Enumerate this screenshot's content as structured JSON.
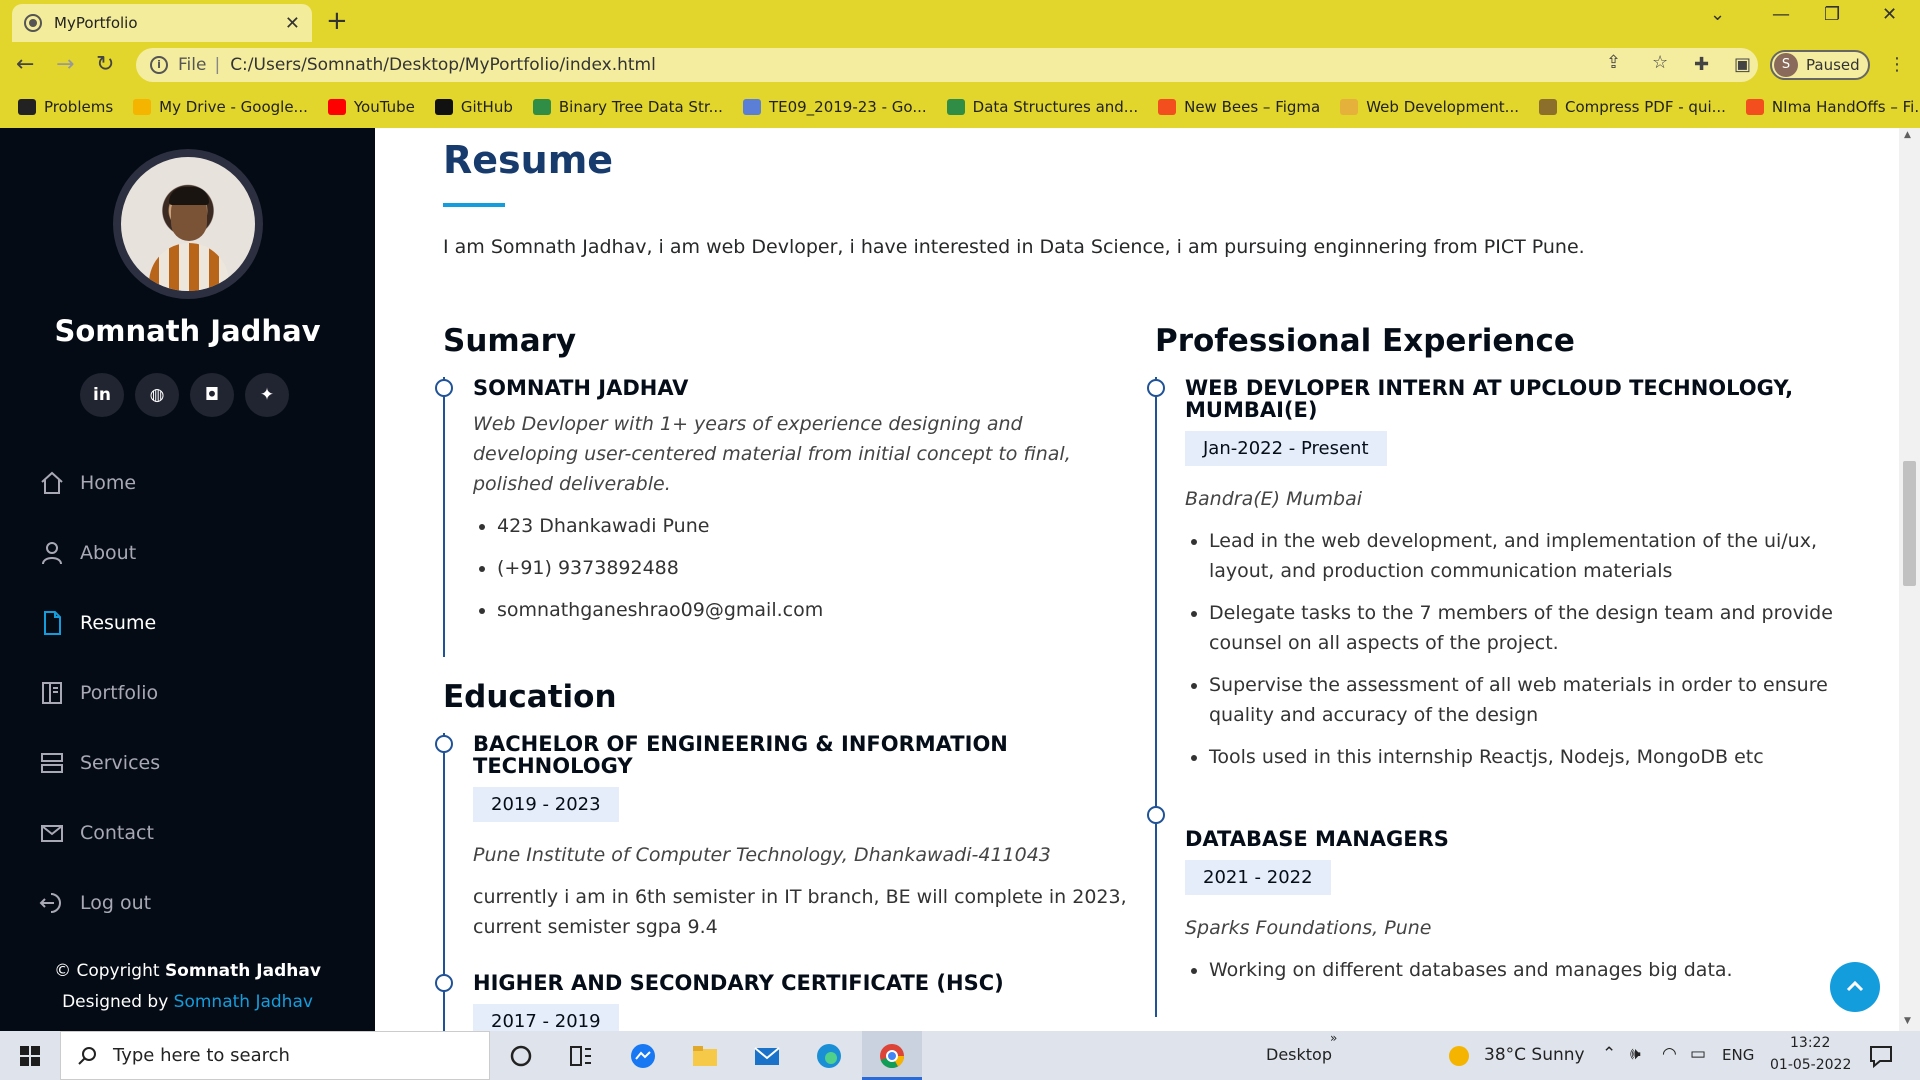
{
  "browser": {
    "tab_title": "MyPortfolio",
    "tab_close": "✕",
    "new_tab": "+",
    "address_scheme": "File",
    "address_sep": "|",
    "address_path": "C:/Users/Somnath/Desktop/MyPortfolio/index.html",
    "profile_initial": "S",
    "profile_status": "Paused",
    "bookmarks": [
      {
        "label": "Problems",
        "color": "#222222"
      },
      {
        "label": "My Drive - Google...",
        "color": "#f4b400"
      },
      {
        "label": "YouTube",
        "color": "#ff0000"
      },
      {
        "label": "GitHub",
        "color": "#111111"
      },
      {
        "label": "Binary Tree Data Str...",
        "color": "#2f8d46"
      },
      {
        "label": "TE09_2019-23 - Go...",
        "color": "#5b7fd6"
      },
      {
        "label": "Data Structures and...",
        "color": "#2f8d46"
      },
      {
        "label": "New Bees – Figma",
        "color": "#f24e1e"
      },
      {
        "label": "Web Development...",
        "color": "#e5b13a"
      },
      {
        "label": "Compress PDF - qui...",
        "color": "#8b6f2a"
      },
      {
        "label": "NIma HandOffs – Fi...",
        "color": "#f24e1e"
      }
    ]
  },
  "sidebar": {
    "name": "Somnath Jadhav",
    "socials": [
      {
        "icon": "linkedin-icon",
        "glyph": "in"
      },
      {
        "icon": "github-icon",
        "glyph": "◍"
      },
      {
        "icon": "instagram-icon",
        "glyph": "◘"
      },
      {
        "icon": "twitter-icon",
        "glyph": "✦"
      }
    ],
    "nav": [
      {
        "label": "Home",
        "icon": "home-icon"
      },
      {
        "label": "About",
        "icon": "user-icon"
      },
      {
        "label": "Resume",
        "icon": "file-icon",
        "active": true
      },
      {
        "label": "Portfolio",
        "icon": "book-icon"
      },
      {
        "label": "Services",
        "icon": "server-icon"
      },
      {
        "label": "Contact",
        "icon": "envelope-icon"
      },
      {
        "label": "Log out",
        "icon": "logout-icon"
      }
    ],
    "copyright_prefix": "© Copyright ",
    "copyright_name": "Somnath Jadhav",
    "designed_prefix": "Designed by ",
    "designed_name": "Somnath Jadhav"
  },
  "main": {
    "title": "Resume",
    "intro": "I am Somnath Jadhav, i am web Devloper, i have interested in Data Science, i am pursuing enginnering from PICT Pune.",
    "summary": {
      "heading": "Sumary",
      "name": "SOMNATH JADHAV",
      "tagline": "Web Devloper with 1+ years of experience designing and developing user-centered material from initial concept to final, polished deliverable.",
      "items": [
        "423 Dhankawadi Pune",
        "(+91) 9373892488",
        "somnathganeshrao09@gmail.com"
      ]
    },
    "education": {
      "heading": "Education",
      "entries": [
        {
          "title": "BACHELOR OF ENGINEERING & INFORMATION TECHNOLOGY",
          "years": "2019 - 2023",
          "place": "Pune Institute of Computer Technology, Dhankawadi-411043",
          "desc": "currently i am in 6th semister in IT branch, BE will complete in 2023, current semister sgpa 9.4"
        },
        {
          "title": "HIGHER AND SECONDARY CERTIFICATE (HSC)",
          "years": "2017 - 2019"
        }
      ]
    },
    "experience": {
      "heading": "Professional Experience",
      "entries": [
        {
          "title": "WEB DEVLOPER INTERN AT UPCLOUD TECHNOLOGY, MUMBAI(E)",
          "years": "Jan-2022 - Present",
          "place": "Bandra(E) Mumbai",
          "bullets": [
            "Lead in the web development, and implementation of the ui/ux, layout, and production communication materials",
            "Delegate tasks to the 7 members of the design team and provide counsel on all aspects of the project.",
            "Supervise the assessment of all web materials in order to ensure quality and accuracy of the design",
            "Tools used in this internship Reactjs, Nodejs, MongoDB etc"
          ]
        },
        {
          "title": "DATABASE MANAGERS",
          "years": "2021 - 2022",
          "place": "Sparks Foundations, Pune",
          "bullets": [
            "Working on different databases and manages big data."
          ]
        }
      ]
    }
  },
  "taskbar": {
    "search_placeholder": "Type here to search",
    "desktop_label": "Desktop",
    "weather": "38°C  Sunny",
    "lang": "ENG",
    "time": "13:22",
    "date": "01-05-2022"
  }
}
